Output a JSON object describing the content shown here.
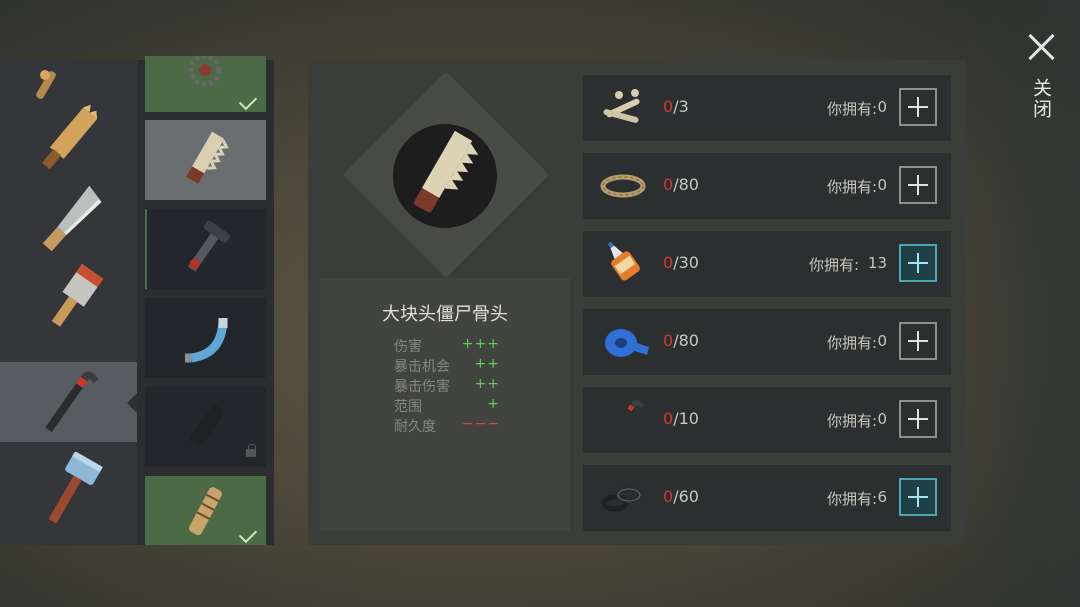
{
  "close": {
    "label": "关闭"
  },
  "weapons": [
    {
      "name": "wooden-stake-icon"
    },
    {
      "name": "wooden-plank-icon"
    },
    {
      "name": "machete-icon"
    },
    {
      "name": "cleaver-icon"
    },
    {
      "name": "crowbar-icon",
      "selected": true
    },
    {
      "name": "sledgehammer-icon"
    }
  ],
  "variants": [
    {
      "name": "gear-variant-icon",
      "state": "done"
    },
    {
      "name": "bone-saw-variant-icon",
      "state": "active"
    },
    {
      "name": "pipe-valve-variant-icon",
      "state": "outlined"
    },
    {
      "name": "bent-pipe-variant-icon",
      "state": "normal"
    },
    {
      "name": "dark-pipe-variant-icon",
      "state": "locked"
    },
    {
      "name": "spiked-bat-variant-icon",
      "state": "done"
    }
  ],
  "item": {
    "title": "大块头僵尸骨头",
    "stats": [
      {
        "name": "伤害",
        "value": "+++",
        "negative": false
      },
      {
        "name": "暴击机会",
        "value": "++",
        "negative": false
      },
      {
        "name": "暴击伤害",
        "value": "++",
        "negative": false
      },
      {
        "name": "范围",
        "value": "+",
        "negative": false
      },
      {
        "name": "耐久度",
        "value": "−−−",
        "negative": true
      }
    ]
  },
  "materials": [
    {
      "icon": "bones-icon",
      "current": "0",
      "required": "/3",
      "own_label": "你拥有:",
      "own": "0",
      "add_active": false
    },
    {
      "icon": "rope-icon",
      "current": "0",
      "required": "/80",
      "own_label": "你拥有:",
      "own": "0",
      "add_active": false
    },
    {
      "icon": "glue-icon",
      "current": "0",
      "required": "/30",
      "own_label": "你拥有:",
      "own": "13",
      "add_active": true
    },
    {
      "icon": "duct-tape-icon",
      "current": "0",
      "required": "/80",
      "own_label": "你拥有:",
      "own": "0",
      "add_active": false
    },
    {
      "icon": "crowbar-icon",
      "current": "0",
      "required": "/10",
      "own_label": "你拥有:",
      "own": "0",
      "add_active": false
    },
    {
      "icon": "rubber-rings-icon",
      "current": "0",
      "required": "/60",
      "own_label": "你拥有:",
      "own": "6",
      "add_active": true
    }
  ]
}
